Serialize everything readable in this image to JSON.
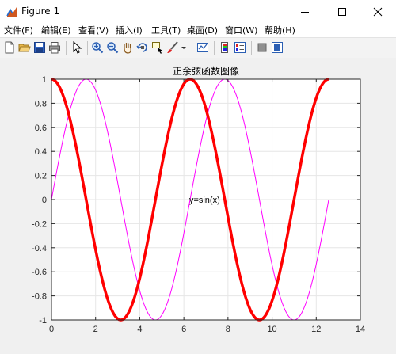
{
  "window": {
    "title": "Figure 1"
  },
  "menu": {
    "items": [
      "文件(F)",
      "编辑(E)",
      "查看(V)",
      "插入(I)",
      "工具(T)",
      "桌面(D)",
      "窗口(W)",
      "帮助(H)"
    ]
  },
  "toolbar": {
    "icons": [
      "new-figure-icon",
      "open-file-icon",
      "save-icon",
      "print-icon",
      "pointer-icon",
      "zoom-in-icon",
      "zoom-out-icon",
      "pan-icon",
      "rotate-3d-icon",
      "data-cursor-icon",
      "brush-icon",
      "link-plot-icon",
      "colorbar-icon",
      "legend-icon",
      "hide-plot-tools-icon",
      "show-plot-tools-icon"
    ]
  },
  "colors": {
    "cos": "#ff0000",
    "sin": "#ff00ff",
    "grid": "#e6e6e6"
  },
  "chart_data": {
    "type": "line",
    "title": "正余弦函数图像",
    "xlim": [
      0,
      14
    ],
    "ylim": [
      -1,
      1
    ],
    "xticks": [
      "0",
      "2",
      "4",
      "6",
      "8",
      "10",
      "12",
      "14"
    ],
    "yticks": [
      "1",
      "0.8",
      "0.6",
      "0.4",
      "0.2",
      "0",
      "-0.2",
      "-0.4",
      "-0.6",
      "-0.8",
      "-1"
    ],
    "grid": true,
    "series": [
      {
        "function": "cos",
        "x_range": [
          0,
          12.566
        ],
        "color": "#ff0000"
      },
      {
        "function": "sin",
        "x_range": [
          0,
          12.566
        ],
        "color": "#ff00ff"
      }
    ],
    "annotations": [
      {
        "text": "y=sin(x)",
        "x": 6.28,
        "y": 0
      }
    ]
  }
}
